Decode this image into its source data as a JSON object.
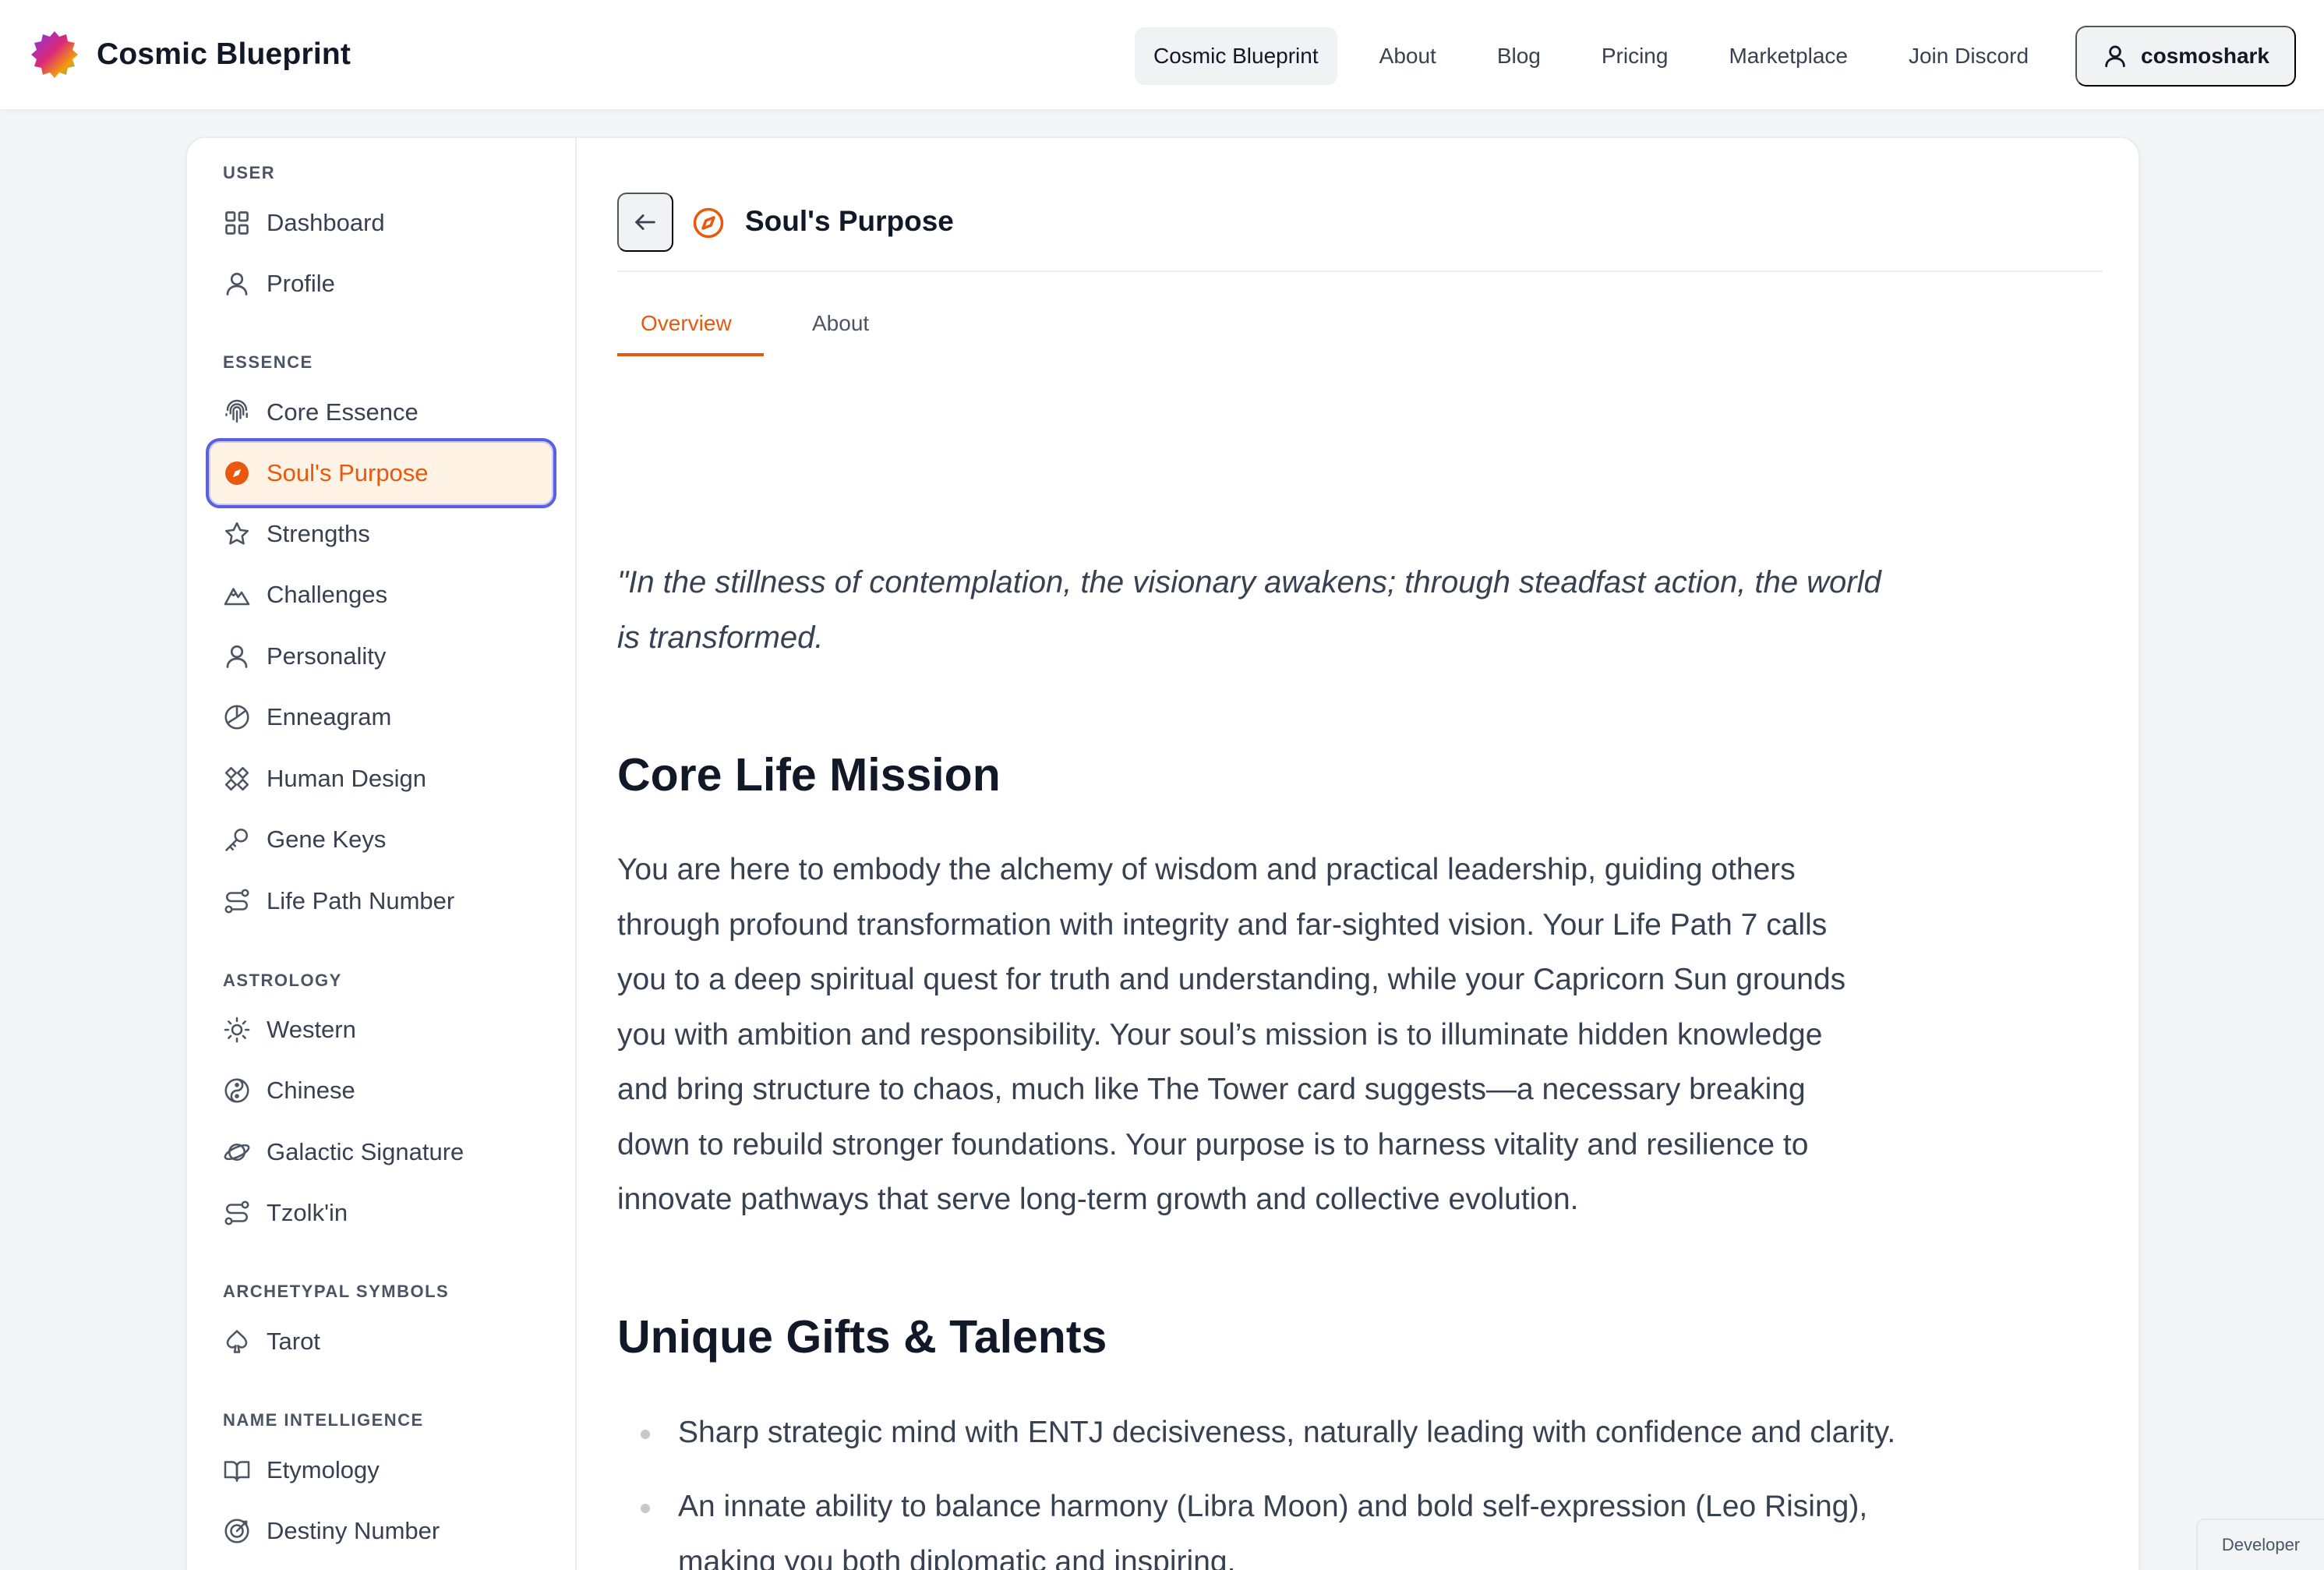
{
  "brand": {
    "name": "Cosmic Blueprint"
  },
  "nav": {
    "items": [
      "Cosmic Blueprint",
      "About",
      "Blog",
      "Pricing",
      "Marketplace",
      "Join Discord"
    ],
    "user": "cosmoshark"
  },
  "sidebar": {
    "sections": [
      {
        "label": "USER",
        "items": [
          {
            "label": "Dashboard",
            "icon": "grid-icon"
          },
          {
            "label": "Profile",
            "icon": "user-icon"
          }
        ]
      },
      {
        "label": "ESSENCE",
        "items": [
          {
            "label": "Core Essence",
            "icon": "fingerprint-icon"
          },
          {
            "label": "Soul's Purpose",
            "icon": "compass-icon",
            "active": true
          },
          {
            "label": "Strengths",
            "icon": "star-icon"
          },
          {
            "label": "Challenges",
            "icon": "mountain-icon"
          },
          {
            "label": "Personality",
            "icon": "user-icon"
          },
          {
            "label": "Enneagram",
            "icon": "circle-segment-icon"
          },
          {
            "label": "Human Design",
            "icon": "bodygraph-icon"
          },
          {
            "label": "Gene Keys",
            "icon": "key-icon"
          },
          {
            "label": "Life Path Number",
            "icon": "path-icon"
          }
        ]
      },
      {
        "label": "ASTROLOGY",
        "items": [
          {
            "label": "Western",
            "icon": "sun-icon"
          },
          {
            "label": "Chinese",
            "icon": "yin-yang-icon"
          },
          {
            "label": "Galactic Signature",
            "icon": "planet-icon"
          },
          {
            "label": "Tzolk'in",
            "icon": "path-icon"
          }
        ]
      },
      {
        "label": "ARCHETYPAL SYMBOLS",
        "items": [
          {
            "label": "Tarot",
            "icon": "spade-icon"
          }
        ]
      },
      {
        "label": "NAME INTELLIGENCE",
        "items": [
          {
            "label": "Etymology",
            "icon": "book-icon"
          },
          {
            "label": "Destiny Number",
            "icon": "target-icon"
          }
        ]
      }
    ]
  },
  "page": {
    "title": "Soul's Purpose",
    "tabs": [
      "Overview",
      "About"
    ],
    "quote": "\"In the stillness of contemplation, the visionary awakens; through steadfast action, the world is transformed.",
    "mission_heading": "Core Life Mission",
    "mission_text": "You are here to embody the alchemy of wisdom and practical leadership, guiding others through profound transformation with integrity and far-sighted vision. Your Life Path 7 calls you to a deep spiritual quest for truth and understanding, while your Capricorn Sun grounds you with ambition and responsibility. Your soul’s mission is to illuminate hidden knowledge and bring structure to chaos, much like The Tower card suggests—a necessary breaking down to rebuild stronger foundations. Your purpose is to harness vitality and resilience to innovate pathways that serve long-term growth and collective evolution.",
    "gifts_heading": "Unique Gifts & Talents",
    "gifts": [
      "Sharp strategic mind with ENTJ decisiveness, naturally leading with confidence and clarity.",
      "An innate ability to balance harmony (Libra Moon) and bold self-expression (Leo Rising), making you both diplomatic and inspiring."
    ]
  },
  "developer_badge": "Developer",
  "colors": {
    "accent": "#ea580c",
    "focus_ring": "#5b5fe0",
    "active_bg": "#fff3e6"
  }
}
